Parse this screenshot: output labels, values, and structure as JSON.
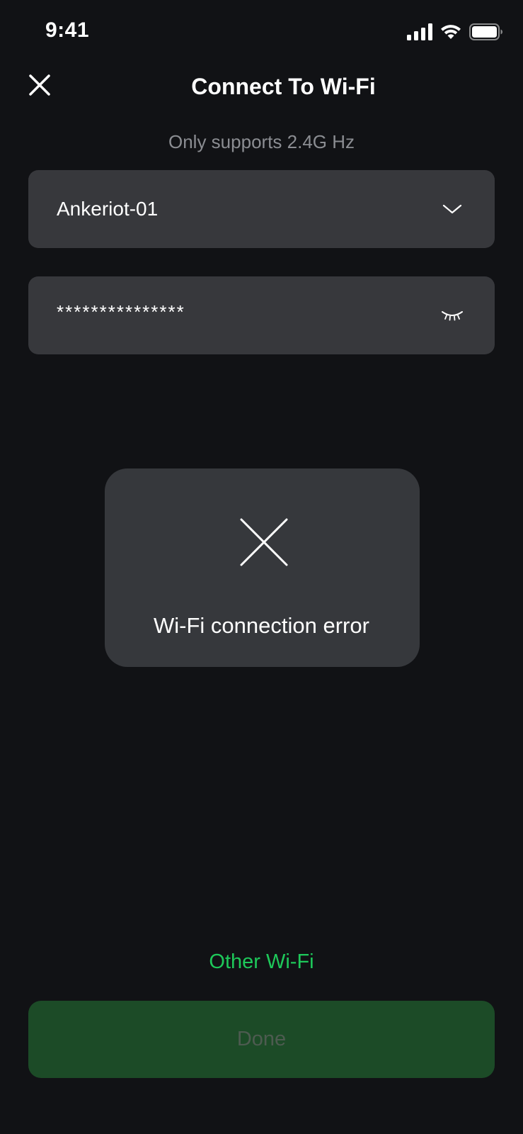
{
  "status_bar": {
    "time": "9:41",
    "icons": [
      "cellular-signal-icon",
      "wifi-icon",
      "battery-icon"
    ]
  },
  "header": {
    "title": "Connect To Wi-Fi",
    "close_icon": "close-icon"
  },
  "subtitle": "Only supports 2.4G Hz",
  "ssid_field": {
    "value": "Ankeriot-01",
    "icon": "chevron-down-icon"
  },
  "password_field": {
    "value": "***************",
    "icon": "eye-closed-icon"
  },
  "error_toast": {
    "icon": "error-x-icon",
    "message": "Wi-Fi connection error"
  },
  "other_wifi_label": "Other Wi-Fi",
  "done_label": "Done",
  "colors": {
    "background": "#111215",
    "field": "#37383c",
    "toast": "#36383c",
    "accent_green": "#1ec85a",
    "done_bg": "#1c4b27",
    "done_text": "#4d5b50",
    "subtitle": "#8b8d92"
  }
}
